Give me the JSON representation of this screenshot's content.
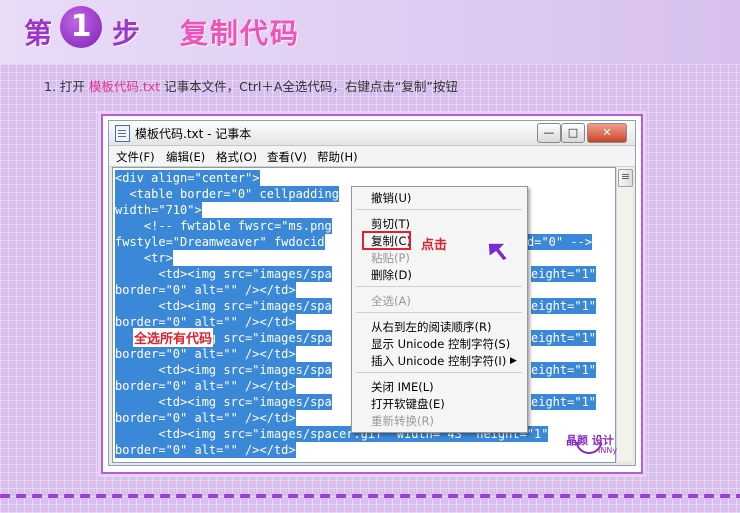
{
  "header": {
    "step_prefix": "第",
    "step_number": "1",
    "step_suffix": "步",
    "title": "复制代码"
  },
  "instruction": {
    "index": "1.",
    "part1": "打开",
    "file_name": "模板代码.txt",
    "part2": "记事本文件，Ctrl＋A全选代码，右键点击“复制”按钮"
  },
  "window": {
    "title": "模板代码.txt - 记事本",
    "buttons": {
      "minimize": "—",
      "maximize": "□",
      "close": "✕"
    },
    "menu": [
      "文件(F)",
      "编辑(E)",
      "格式(O)",
      "查看(V)",
      "帮助(H)"
    ]
  },
  "code_lines": [
    "<div align=\"center\">",
    "  <table border=\"0\" cellpadding",
    "width=\"710\">",
    "    <!-- fwtable fwsrc=\"ms.png",
    "fwstyle=\"Dreamweaver\" fwdocid",
    "    <tr>",
    "      <td><img src=\"images/spa",
    "border=\"0\" alt=\"\" /></td>",
    "      <td><img src=\"images/spa",
    "border=\"0\" alt=\"\" /></td>",
    "      <td><img src=\"images/spa",
    "border=\"0\" alt=\"\" /></td>",
    "      <td><img src=\"images/spa",
    "border=\"0\" alt=\"\" /></td>",
    "      <td><img src=\"images/spa",
    "border=\"0\" alt=\"\" /></td>",
    "      <td><img src=\"images/spacer.gif\" width=\"43\" height=\"1\"",
    "border=\"0\" alt=\"\" /></td>"
  ],
  "code_right_fragments": [
    "",
    "",
    "",
    "\"",
    "d=\"0\" -->",
    "",
    "eight=\"1\"",
    "",
    "eight=\"1\"",
    "",
    "eight=\"1\"",
    "",
    "eight=\"1\"",
    "",
    "eight=\"1\"",
    "",
    "",
    ""
  ],
  "context_menu": {
    "undo": "撤销(U)",
    "cut": "剪切(T)",
    "copy": "复制(C)",
    "paste": "粘贴(P)",
    "delete": "删除(D)",
    "select_all": "全选(A)",
    "rtl": "从右到左的阅读顺序(R)",
    "show_unicode": "显示 Unicode 控制字符(S)",
    "insert_unicode": "插入 Unicode 控制字符(I)",
    "close_ime": "关闭 IME(L)",
    "soft_keyboard": "打开软键盘(E)",
    "reconvert": "重新转换(R)"
  },
  "annotations": {
    "click": "点击",
    "select_all": "全选所有代码"
  },
  "logo": {
    "main": "晶颜 设计",
    "sub": "INNy"
  },
  "colors": {
    "accent": "#9b36c8",
    "title": "#ef52b8",
    "highlight": "#3b88d8",
    "annotation": "#e0202d"
  }
}
